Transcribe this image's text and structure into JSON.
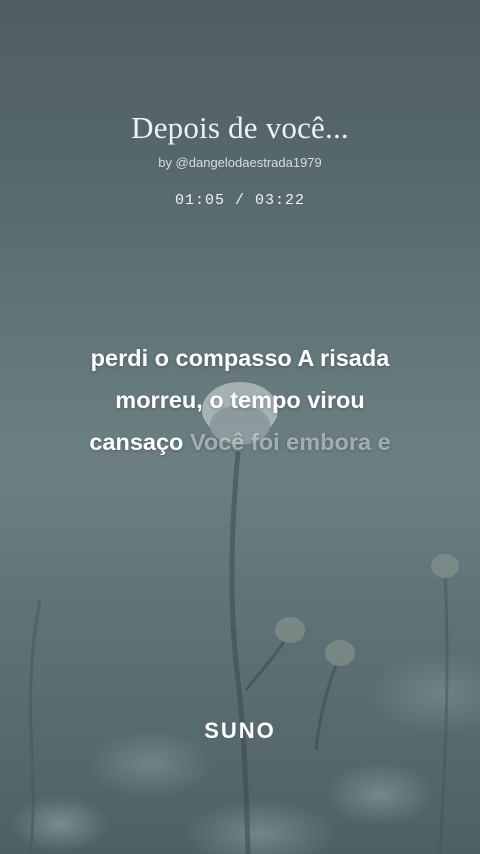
{
  "song": {
    "title": "Depois de você...",
    "artist": "by @dangelodaestrada1979",
    "time": "01:05 / 03:22"
  },
  "lyrics": {
    "line1": "perdi o compasso A risada",
    "line2": "morreu, o tempo virou",
    "line3_sung": "cansaço",
    "line3_upcoming": "Você foi embora e"
  },
  "brand": {
    "logo_text": "SUNO"
  },
  "colors": {
    "background": "#5f7377",
    "text": "#ffffff",
    "upcoming_text": "rgba(255,255,255,0.45)"
  },
  "background_image": "frosted-flower-photo"
}
